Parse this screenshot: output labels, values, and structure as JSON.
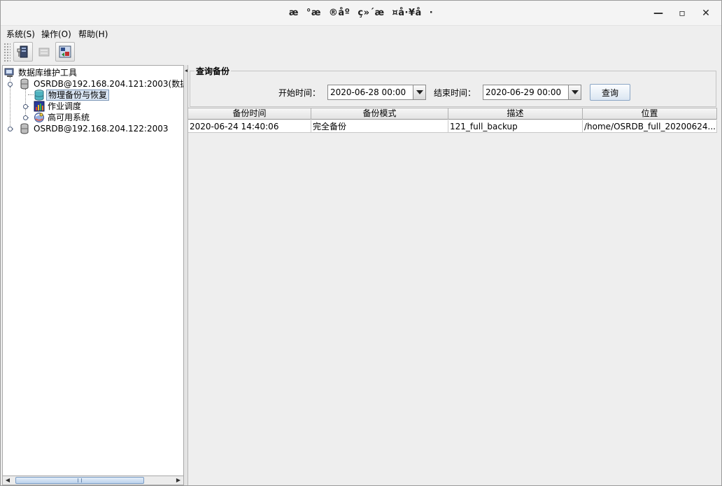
{
  "window": {
    "title": "æ°æ®åºç»´æ¤å·¥å·"
  },
  "menu": [
    {
      "label": "系统(S)"
    },
    {
      "label": "操作(O)"
    },
    {
      "label": "帮助(H)"
    }
  ],
  "tree": {
    "root": "数据库维护工具",
    "node1": "OSRDB@192.168.204.121:2003(数据",
    "node1_children": [
      "物理备份与恢复",
      "作业调度",
      "高可用系统"
    ],
    "node2": "OSRDB@192.168.204.122:2003"
  },
  "query": {
    "group_title": "查询备份",
    "start_label": "开始时间：",
    "start_value": "2020-06-28 00:00",
    "end_label": "结束时间：",
    "end_value": "2020-06-29 00:00",
    "query_button": "查询"
  },
  "table": {
    "columns": [
      "备份时间",
      "备份模式",
      "描述",
      "位置"
    ],
    "rows": [
      [
        "2020-06-24 14:40:06",
        "完全备份",
        "121_full_backup",
        "/home/OSRDB_full_20200624..."
      ]
    ]
  },
  "colors": {
    "selection": "#d9e5f3",
    "thumb": "#bcd2ec"
  }
}
